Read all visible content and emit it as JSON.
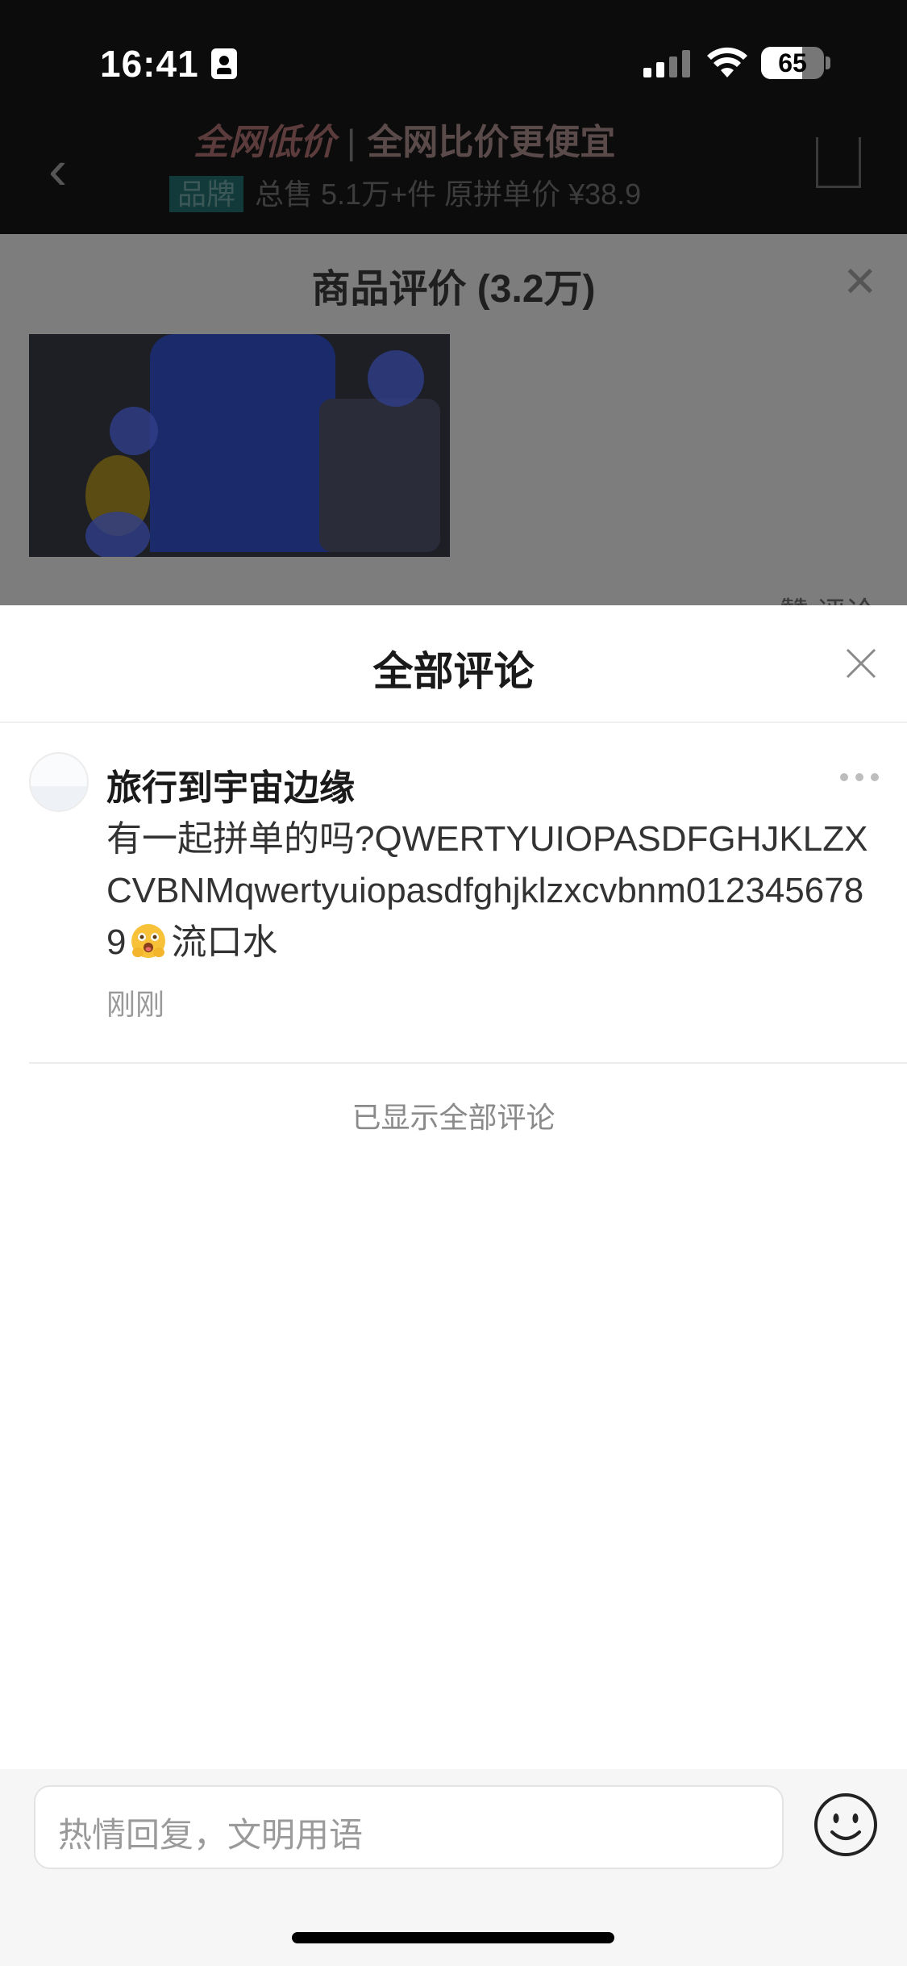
{
  "status_bar": {
    "time": "16:41",
    "battery": "65"
  },
  "background_page": {
    "banner_prefix": "全网",
    "banner_highlight": "低价",
    "banner_text": "全网比价更便宜",
    "sub_tag": "品牌",
    "sub_text": "总售 5.1万+件  原拼单价 ¥38.9",
    "review_title": "商品评价 (3.2万)",
    "review_meta": "赞  评论"
  },
  "sheet": {
    "title": "全部评论",
    "comment": {
      "username": "旅行到宇宙边缘",
      "text_before_emoji": "有一起拼单的吗?QWERTYUIOPASDFGHJKLZXCVBNMqwertyuiopasdfghjklzxcvbnm0123456789",
      "emoji": "drooling-face",
      "text_after_emoji": "流口水",
      "time": "刚刚"
    },
    "end_text": "已显示全部评论",
    "input_placeholder": "热情回复，文明用语"
  },
  "colors": {
    "sheet_bg": "#ffffff",
    "overlay": "#7d7d7d",
    "text_primary": "#1a1a1a",
    "text_secondary": "#999999"
  }
}
